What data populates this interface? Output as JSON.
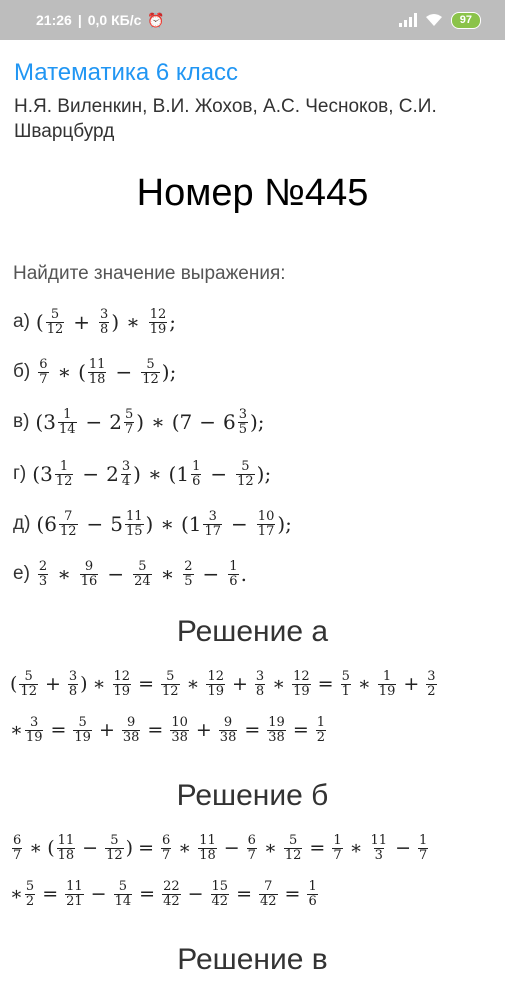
{
  "status": {
    "time": "21:26",
    "speed": "0,0 КБ/с",
    "battery": "97"
  },
  "header": {
    "title": "Математика 6 класс",
    "authors": "Н.Я. Виленкин, В.И. Жохов, А.С. Чесноков, С.И. Шварцбурд"
  },
  "problem": {
    "title": "Номер №445",
    "task": "Найдите значение выражения:",
    "items": [
      "а)",
      "б)",
      "в)",
      "г)",
      "д)",
      "е)"
    ]
  },
  "solutions": {
    "a": "Решение а",
    "b": "Решение б",
    "c": "Решение в"
  },
  "colors": {
    "title": "#2196f3",
    "statusbar": "#bdbdbd",
    "battery": "#8bc34a"
  }
}
